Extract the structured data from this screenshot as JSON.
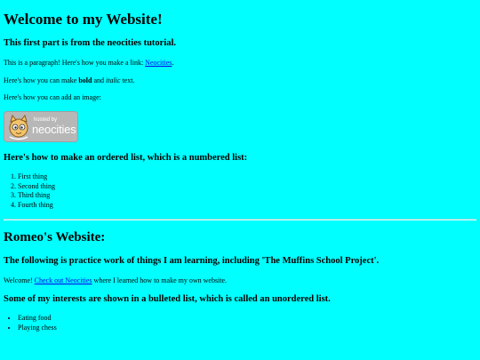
{
  "header": {
    "title": "Welcome to my Website!",
    "subtitle": "This first part is from the neocities tutorial."
  },
  "intro": {
    "link_prefix": "This is a paragraph! Here's how you make a link: ",
    "link_text": "Neocities",
    "link_suffix": ".",
    "format_prefix": "Here's how you can make ",
    "bold_text": "bold",
    "format_middle": " and ",
    "italic_text": "italic",
    "format_suffix": " text.",
    "image_text": "Here's how you can add an image:"
  },
  "badge": {
    "small_text": "hosted by",
    "big_text": "neocities"
  },
  "ordered": {
    "heading": "Here's how to make an ordered list, which is a numbered list:",
    "items": [
      "First thing",
      "Second thing",
      "Third thing",
      "Fourth thing"
    ]
  },
  "romeo": {
    "title": "Romeo's Website:",
    "subtitle": "The following is practice work of things I am learning, including 'The Muffins School Project'.",
    "welcome_prefix": "Welcome! ",
    "welcome_link": "Check out Neocities",
    "welcome_suffix": " where I learned how to make my own website.",
    "interests_heading": "Some of my interests are shown in a bulleted list, which is called an unordered list.",
    "interests": [
      "Eating food",
      "Playing chess"
    ]
  }
}
